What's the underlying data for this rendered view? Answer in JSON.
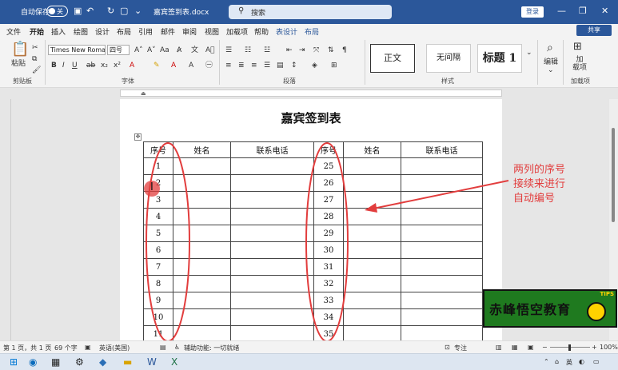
{
  "titlebar": {
    "autosave_label": "自动保存",
    "autosave_state": "关",
    "doc_name": "嘉宾签到表.docx",
    "search_placeholder": "搜索",
    "login": "登录"
  },
  "menu": [
    {
      "label": "文件"
    },
    {
      "label": "开始"
    },
    {
      "label": "插入"
    },
    {
      "label": "绘图"
    },
    {
      "label": "设计"
    },
    {
      "label": "布局"
    },
    {
      "label": "引用"
    },
    {
      "label": "邮件"
    },
    {
      "label": "审阅"
    },
    {
      "label": "视图"
    },
    {
      "label": "加载项"
    },
    {
      "label": "帮助"
    },
    {
      "label": "表设计"
    },
    {
      "label": "布局"
    }
  ],
  "share_label": "共享",
  "ribbon": {
    "paste_label": "粘贴",
    "font_name": "Times New Roma",
    "font_size": "四号",
    "styles": [
      "正文",
      "无间隔",
      "标题 1"
    ],
    "edit_label": "编辑",
    "addin_label": "加\n载项",
    "groups": {
      "clipboard": "剪贴板",
      "font": "字体",
      "paragraph": "段落",
      "styles": "样式",
      "addins": "加载项"
    }
  },
  "document": {
    "title": "嘉宾签到表",
    "headers": [
      "序号",
      "姓名",
      "联系电话",
      "序号",
      "姓名",
      "联系电话"
    ],
    "rows": [
      [
        "1",
        "25"
      ],
      [
        "2",
        "26"
      ],
      [
        "3",
        "27"
      ],
      [
        "4",
        "28"
      ],
      [
        "5",
        "29"
      ],
      [
        "6",
        "30"
      ],
      [
        "7",
        "31"
      ],
      [
        "8",
        "32"
      ],
      [
        "9",
        "33"
      ],
      [
        "10",
        "34"
      ],
      [
        "11",
        "35"
      ]
    ]
  },
  "annotation": "两列的序号\n接续来进行\n自动编号",
  "logo": {
    "text": "赤峰悟空教育",
    "tips": "TIPS"
  },
  "statusbar": {
    "page": "第 1 页，共 1 页",
    "words": "69 个字",
    "language": "英语(美国)",
    "accessibility": "辅助功能: 一切就绪",
    "focus": "专注",
    "zoom": "100%"
  },
  "taskbar": {
    "ime": "英"
  },
  "colors": {
    "brand": "#2b579a",
    "annotation": "#e23d3d"
  }
}
